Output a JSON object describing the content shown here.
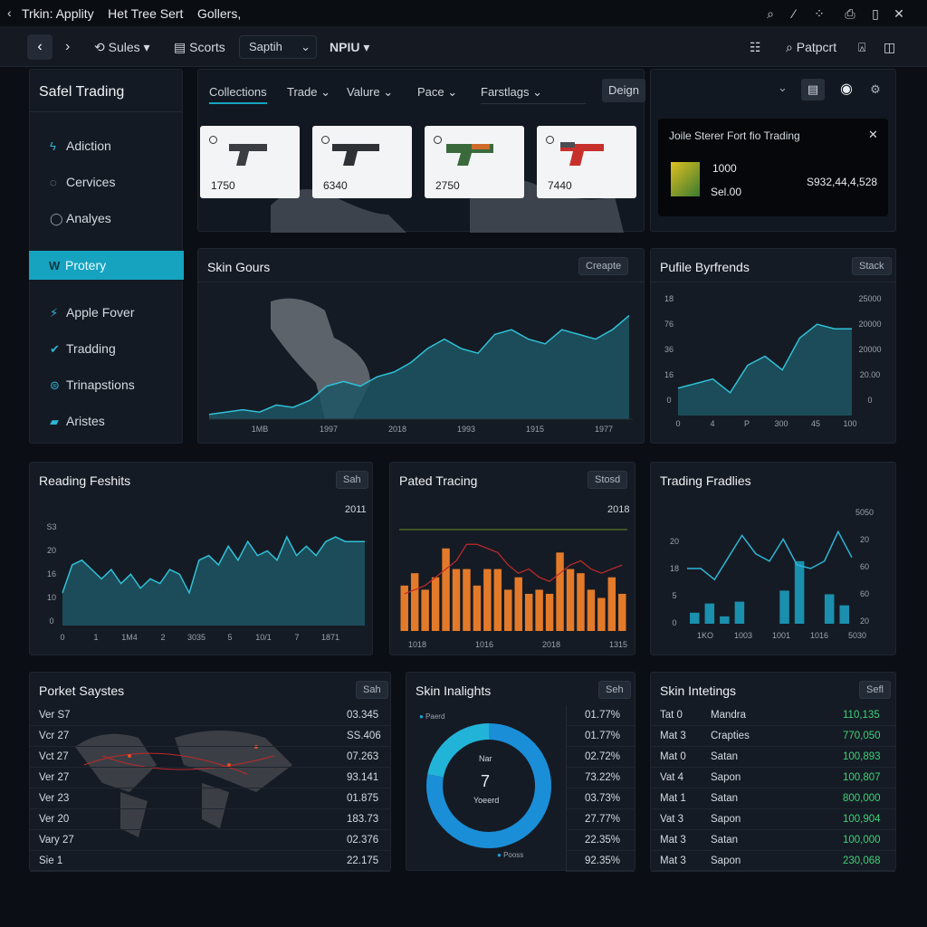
{
  "window": {
    "title": "Trkin: Applity    Het Tree Sert    Gollers,"
  },
  "navbar": {
    "sales": "Sules",
    "scorts": "Scorts",
    "search_value": "Saptih",
    "menu": "NPIU",
    "right_label": "Patpcrt"
  },
  "sidebar": {
    "title": "Safel Trading",
    "items": [
      {
        "label": "Adiction",
        "icon": "lightning-icon"
      },
      {
        "label": "Cervices",
        "icon": "refresh-icon"
      },
      {
        "label": "Analyes",
        "icon": "search-icon"
      },
      {
        "label": "Protery",
        "icon": "w-icon",
        "active": true
      },
      {
        "label": "Apple Fover",
        "icon": "bolt-icon"
      },
      {
        "label": "Tradding",
        "icon": "check-icon"
      },
      {
        "label": "Trinapstions",
        "icon": "chat-icon"
      },
      {
        "label": "Aristes",
        "icon": "bag-icon"
      }
    ]
  },
  "tabs": [
    "Collections",
    "Trade",
    "Valure",
    "Pace",
    "Farstlags",
    "Deign"
  ],
  "skins": [
    {
      "price": "1750",
      "color": "#3a3d42"
    },
    {
      "price": "6340",
      "color": "#2e3236"
    },
    {
      "price": "2750",
      "color": "#3a6a3c"
    },
    {
      "price": "7440",
      "color": "#c8302c"
    }
  ],
  "tradeBox": {
    "title": "Joile Sterer Fort fio Trading",
    "qty": "1000",
    "sell": "Sel.00",
    "amount": "S932,44,4,528"
  },
  "skinGours": {
    "title": "Skin Gours",
    "button": "Creapte",
    "chart_data": {
      "type": "area",
      "x": [
        "1MB",
        "1997",
        "2018",
        "1993",
        "1915",
        "1977"
      ],
      "values": [
        2,
        3,
        4,
        3,
        6,
        5,
        8,
        14,
        16,
        14,
        18,
        20,
        24,
        30,
        34,
        30,
        28,
        36,
        38,
        34,
        32,
        38,
        36,
        34,
        38,
        44
      ],
      "ylim": [
        0,
        50
      ]
    }
  },
  "pufile": {
    "title": "Pufile Byrfrends",
    "button": "Stack",
    "left_ticks": [
      "18",
      "76",
      "36",
      "16",
      "0"
    ],
    "right_ticks": [
      "25000",
      "20000",
      "20000",
      "20.00",
      "0"
    ],
    "x_ticks": [
      "0",
      "4",
      "P",
      "300",
      "45",
      "100"
    ],
    "chart_data": {
      "type": "area",
      "values": [
        12,
        14,
        16,
        10,
        22,
        26,
        20,
        34,
        40,
        38,
        38
      ],
      "ylim": [
        0,
        50
      ]
    }
  },
  "reading": {
    "title": "Reading Feshits",
    "button": "Sah",
    "year": "2011",
    "y_ticks": [
      "S3",
      "20",
      "16",
      "10",
      "0"
    ],
    "x_ticks": [
      "0",
      "1",
      "1M4",
      "2",
      "3035",
      "5",
      "10/1",
      "7",
      "1871"
    ],
    "chart_data": {
      "type": "area",
      "values": [
        14,
        26,
        28,
        24,
        20,
        24,
        18,
        22,
        16,
        20,
        18,
        24,
        22,
        14,
        28,
        30,
        26,
        34,
        28,
        36,
        30,
        32,
        28,
        38,
        30,
        34,
        30,
        36,
        38,
        36,
        36,
        36
      ],
      "ylim": [
        0,
        45
      ]
    }
  },
  "pated": {
    "title": "Pated Tracing",
    "button": "Stosd",
    "year": "2018",
    "x_ticks": [
      "1018",
      "1016",
      "2018",
      "1315"
    ],
    "chart_data": {
      "type": "bar",
      "values": [
        22,
        28,
        20,
        26,
        40,
        30,
        30,
        22,
        30,
        30,
        20,
        26,
        18,
        20,
        18,
        38,
        30,
        28,
        20,
        16,
        26,
        18
      ],
      "line": [
        18,
        20,
        22,
        26,
        30,
        34,
        42,
        42,
        40,
        38,
        32,
        28,
        30,
        26,
        24,
        28,
        32,
        34,
        30,
        28,
        30,
        32
      ],
      "ylim": [
        0,
        50
      ]
    }
  },
  "tradingFrad": {
    "title": "Trading Fradlies",
    "left_ticks": [
      "20",
      "18",
      "5",
      "0"
    ],
    "right_ticks": [
      "5050",
      "20",
      "60",
      "60",
      "20"
    ],
    "x_ticks": [
      "1KO",
      "1003",
      "1001",
      "1016",
      "5030"
    ],
    "chart_data": {
      "type": "bar",
      "values": [
        6,
        11,
        4,
        12,
        0,
        0,
        18,
        34,
        0,
        16,
        10
      ],
      "line": [
        30,
        30,
        24,
        36,
        48,
        38,
        34,
        46,
        32,
        30,
        34,
        50,
        36
      ],
      "ylim": [
        0,
        60
      ]
    }
  },
  "pocket": {
    "title": "Porket Saystes",
    "button": "Sah",
    "rows": [
      {
        "label": "Ver S7",
        "value": "03.345"
      },
      {
        "label": "Vcr 27",
        "value": "SS.406"
      },
      {
        "label": "Vct 27",
        "value": "07.263"
      },
      {
        "label": "Ver 27",
        "value": "93.141"
      },
      {
        "label": "Ver 23",
        "value": "01.875"
      },
      {
        "label": "Ver 20",
        "value": "183.73"
      },
      {
        "label": "Vary 27",
        "value": "02.376"
      },
      {
        "label": "Sie 1",
        "value": "22.175"
      }
    ]
  },
  "insights": {
    "title": "Skin Inalights",
    "button": "Seh",
    "legend_top": "Paerd",
    "legend_bottom": "Pooss",
    "donut_label": "Nar",
    "donut_value": "7",
    "donut_sub": "Yoeerd",
    "chart_data": {
      "type": "pie",
      "values": [
        78,
        22
      ]
    },
    "percents": [
      "01.77%",
      "01.77%",
      "02.72%",
      "73.22%",
      "03.73%",
      "27.77%",
      "22.35%",
      "92.35%"
    ]
  },
  "intetings": {
    "title": "Skin Intetings",
    "button": "Sefl",
    "rows": [
      {
        "c1": "Tat 0",
        "c2": "Mandra",
        "c3": "110,135"
      },
      {
        "c1": "Mat 3",
        "c2": "Crapties",
        "c3": "770,050"
      },
      {
        "c1": "Mat 0",
        "c2": "Satan",
        "c3": "100,893"
      },
      {
        "c1": "Vat 4",
        "c2": "Sapon",
        "c3": "100,807"
      },
      {
        "c1": "Mat 1",
        "c2": "Satan",
        "c3": "800,000"
      },
      {
        "c1": "Vat 3",
        "c2": "Sapon",
        "c3": "100,904"
      },
      {
        "c1": "Mat 3",
        "c2": "Satan",
        "c3": "100,000"
      },
      {
        "c1": "Mat 3",
        "c2": "Sapon",
        "c3": "230,068"
      }
    ]
  },
  "colors": {
    "accent": "#16a3c0",
    "area": "#1f5b68",
    "bar": "#e37a2a",
    "green": "#3fd17a"
  }
}
